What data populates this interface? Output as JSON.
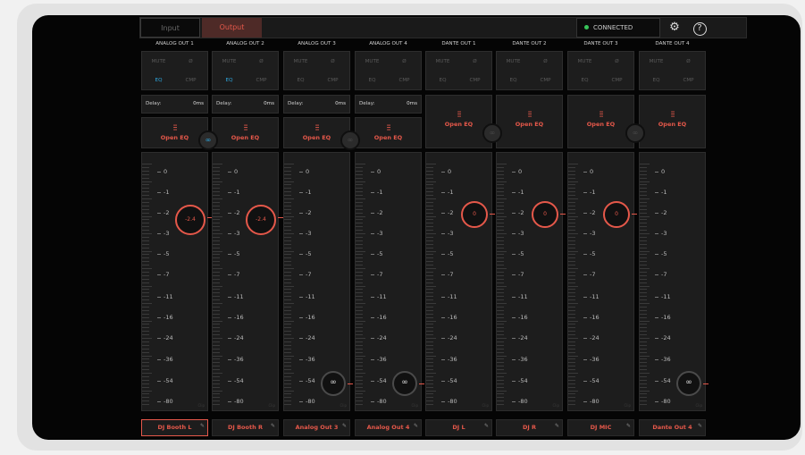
{
  "tabs": {
    "input": "Input",
    "output": "Output"
  },
  "status": {
    "connected": "CONNECTED"
  },
  "icons": {
    "settings": "gear-icon",
    "help": "?"
  },
  "accent": "#e5584a",
  "blue": "#2fa8e0",
  "labels": {
    "mute": "MUTE",
    "phase": "Ø",
    "eq": "EQ",
    "cmp": "CMP",
    "delay": "Delay:",
    "open_eq": "Open EQ",
    "eq_glyph": "⫶⫶⫶",
    "inf": "∞",
    "clip": "Clip",
    "pencil": "✎"
  },
  "scale": [
    "0",
    "-1",
    "-2",
    "-3",
    "-5",
    "-7",
    "-11",
    "-16",
    "-24",
    "-36",
    "-54",
    "-80"
  ],
  "channels": [
    {
      "name": "ANALOG OUT 1",
      "label": "DJ Booth L",
      "delay": "0ms",
      "eq_on": true,
      "level": "-2.4"
    },
    {
      "name": "ANALOG OUT 2",
      "label": "DJ Booth R",
      "delay": "0ms",
      "eq_on": true,
      "level": "-2.4"
    },
    {
      "name": "ANALOG OUT 3",
      "label": "Analog Out 3",
      "delay": "0ms",
      "eq_on": false,
      "level": "∞"
    },
    {
      "name": "ANALOG OUT 4",
      "label": "Analog Out 4",
      "delay": "0ms",
      "eq_on": false,
      "level": "∞"
    },
    {
      "name": "DANTE OUT 1",
      "label": "DJ L",
      "eq_on": false,
      "level": "0"
    },
    {
      "name": "DANTE OUT 2",
      "label": "DJ R",
      "eq_on": false,
      "level": "0"
    },
    {
      "name": "DANTE OUT 3",
      "label": "DJ MIC",
      "eq_on": false,
      "level": "0"
    },
    {
      "name": "DANTE OUT 4",
      "label": "Dante Out 4",
      "eq_on": false,
      "level": "∞"
    }
  ]
}
